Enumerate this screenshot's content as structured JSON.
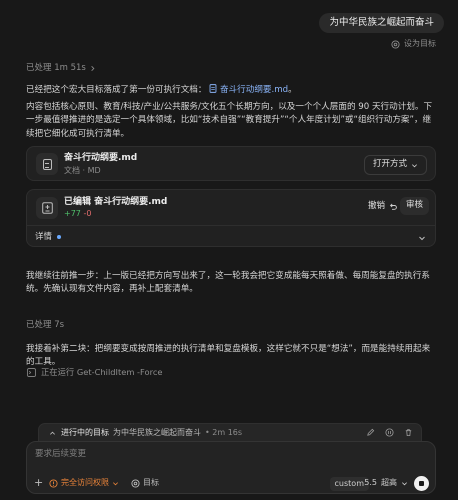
{
  "user_message": "为中华民族之崛起而奋斗",
  "set_goal_label": "设为目标",
  "processed_1": "已处理 1m 51s",
  "msg1": {
    "line1_pre": "已经把这个宏大目标落成了第一份可执行文档：",
    "line1_file": "奋斗行动纲要.md",
    "line1_post": "。",
    "body": "内容包括核心原则、教育/科技/产业/公共服务/文化五个长期方向，以及一个个人层面的 90 天行动计划。下一步最值得推进的是选定一个具体领域，比如“技术自强”“教育提升”“个人年度计划”或“组织行动方案”，继续把它细化成可执行清单。"
  },
  "file_card": {
    "title": "奋斗行动纲要.md",
    "subtitle": "文档 · MD",
    "open_label": "打开方式"
  },
  "edit_card": {
    "title": "已编辑 奋斗行动纲要.md",
    "added": "+77",
    "removed": "-0",
    "undo_label": "撤销",
    "review_label": "审核",
    "details_label": "详情"
  },
  "msg2": "我继续往前推一步：上一版已经把方向写出来了，这一轮我会把它变成能每天照着做、每周能复盘的执行系统。先确认现有文件内容，再补上配套清单。",
  "processed_2": "已处理 7s",
  "msg3": "我接着补第二块：把纲要变成按周推进的执行清单和复盘模板，这样它就不只是“想法”，而是能持续用起来的工具。",
  "running_cmd": "正在运行 Get-ChildItem -Force",
  "goal_bar": {
    "label": "进行中的目标",
    "goal": "为中华民族之崛起而奋斗",
    "time": "• 2m 16s"
  },
  "composer": {
    "placeholder": "要求后续变更",
    "access_label": "完全访问权限",
    "target_label": "目标",
    "custom_label": "custom",
    "model_label": "5.5",
    "speed_label": "超高"
  },
  "colors": {
    "accent_link": "#8ab4f8",
    "access_orange": "#e8833a",
    "added_green": "#4fbf6a",
    "removed_red": "#e06c6c"
  }
}
